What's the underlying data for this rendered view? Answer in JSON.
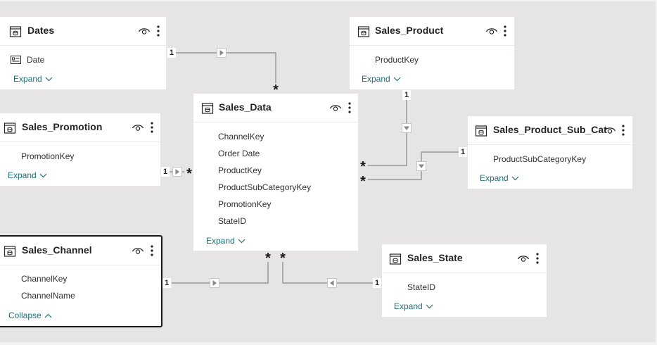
{
  "tables": {
    "dates": {
      "title": "Dates",
      "fields": [
        "Date"
      ],
      "action": "Expand"
    },
    "sales_product": {
      "title": "Sales_Product",
      "fields": [
        "ProductKey"
      ],
      "action": "Expand"
    },
    "sales_data": {
      "title": "Sales_Data",
      "fields": [
        "ChannelKey",
        "Order Date",
        "ProductKey",
        "ProductSubCategoryKey",
        "PromotionKey",
        "StateID"
      ],
      "action": "Expand"
    },
    "sales_promotion": {
      "title": "Sales_Promotion",
      "fields": [
        "PromotionKey"
      ],
      "action": "Expand"
    },
    "sales_product_sub_cat": {
      "title": "Sales_Product_Sub_Cat",
      "fields": [
        "ProductSubCategoryKey"
      ],
      "action": "Expand"
    },
    "sales_channel": {
      "title": "Sales_Channel",
      "fields": [
        "ChannelKey",
        "ChannelName"
      ],
      "action": "Collapse"
    },
    "sales_state": {
      "title": "Sales_State",
      "fields": [
        "StateID"
      ],
      "action": "Expand"
    }
  },
  "cardinality": {
    "one": "1",
    "many": "*"
  },
  "colors": {
    "canvas": "#e7e5e3",
    "card": "#ffffff",
    "link": "#8a8886",
    "accent": "#1f6f79"
  },
  "icons": {
    "table": "table-icon",
    "visibility": "eye-icon",
    "menu": "more-options-icon",
    "date_field": "date-field-icon"
  }
}
